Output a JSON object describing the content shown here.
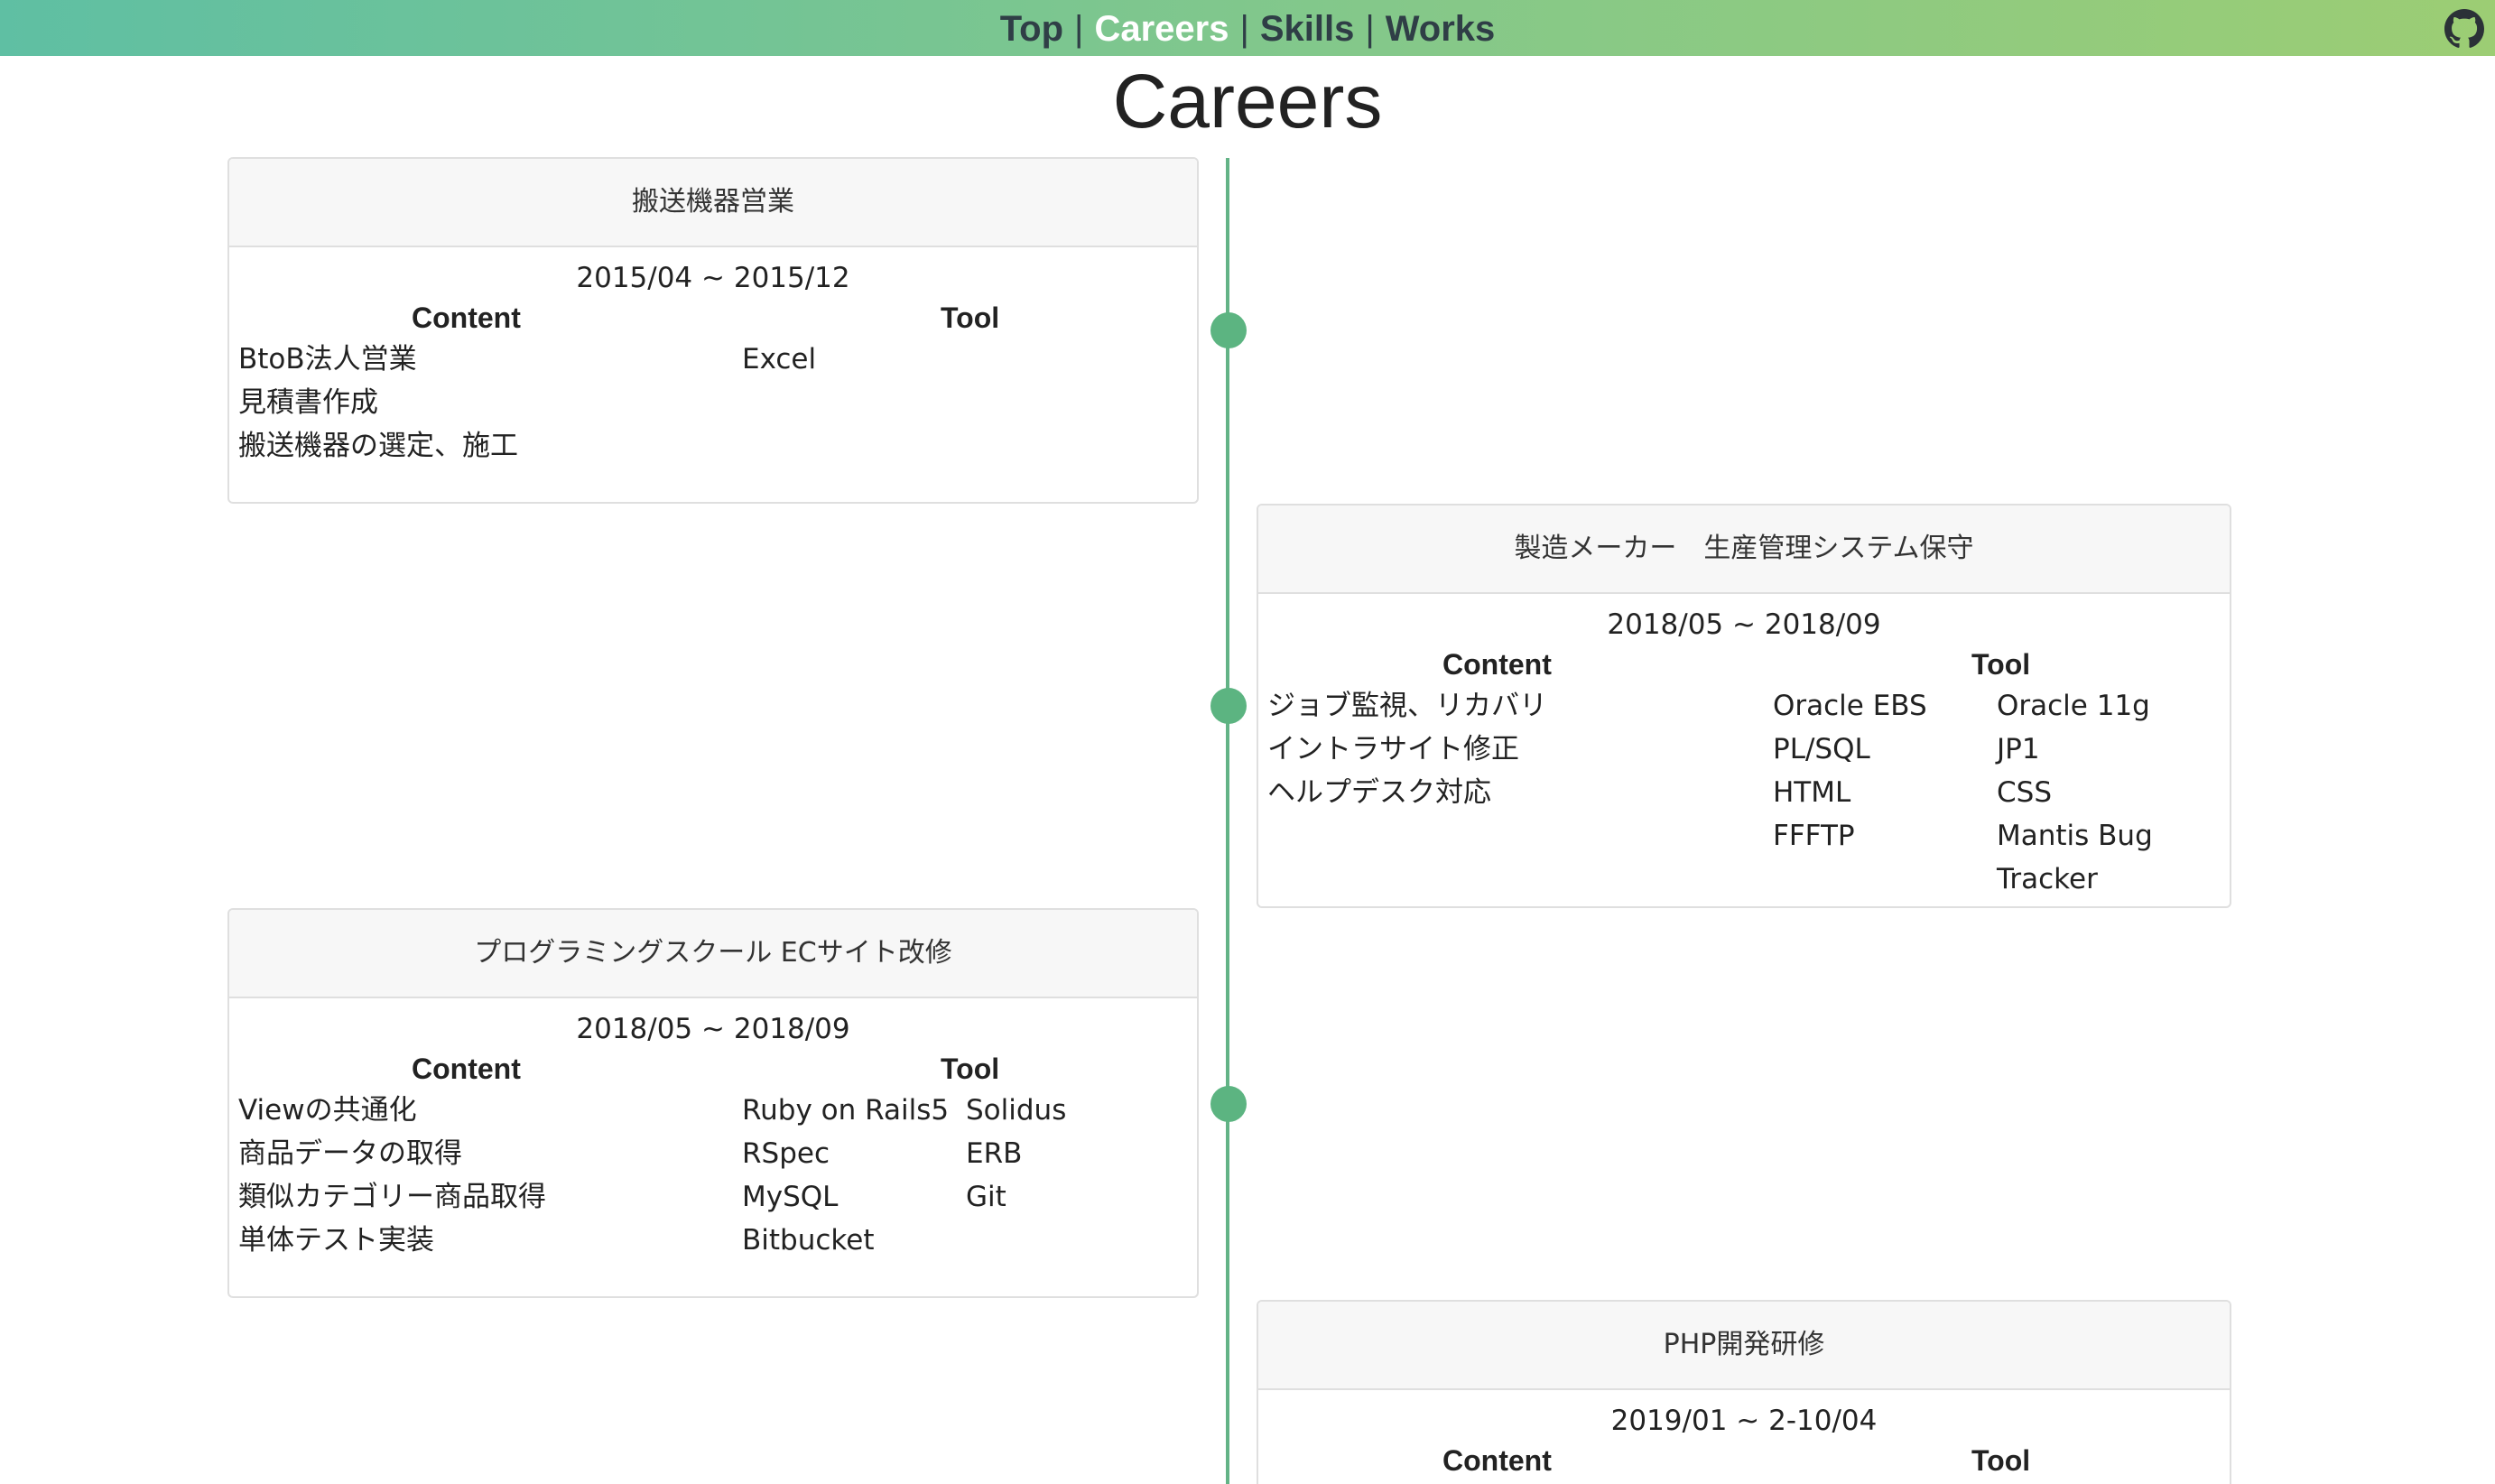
{
  "nav": {
    "links": [
      "Top",
      "Careers",
      "Skills",
      "Works"
    ],
    "separator": "|",
    "active": "Careers",
    "github_icon": "github-icon"
  },
  "page": {
    "title": "Careers"
  },
  "colors": {
    "accent": "#5cb481",
    "nav_gradient_start": "#5fbfa3",
    "nav_gradient_end": "#9ccd74",
    "active_link": "#ffffff"
  },
  "careers": [
    {
      "title": "搬送機器営業",
      "period": "2015/04 ~ 2015/12",
      "content_label": "Content",
      "tool_label": "Tool",
      "content": [
        "BtoB法人営業",
        "見積書作成",
        "搬送機器の選定、施工"
      ],
      "tools_col1": [
        "Excel"
      ],
      "tools_col2": []
    },
    {
      "title": "製造メーカー　生産管理システム保守",
      "period": "2018/05 ~ 2018/09",
      "content_label": "Content",
      "tool_label": "Tool",
      "content": [
        "ジョブ監視、リカバリ",
        "イントラサイト修正",
        "ヘルプデスク対応"
      ],
      "tools_col1": [
        "Oracle EBS",
        "PL/SQL",
        "HTML",
        "FFFTP"
      ],
      "tools_col2": [
        "Oracle 11g",
        "JP1",
        "CSS",
        "Mantis Bug",
        "Tracker"
      ]
    },
    {
      "title": "プログラミングスクール ECサイト改修",
      "period": "2018/05 ~ 2018/09",
      "content_label": "Content",
      "tool_label": "Tool",
      "content": [
        "Viewの共通化",
        "商品データの取得",
        "類似カテゴリー商品取得",
        "単体テスト実装"
      ],
      "tools_col1": [
        "Ruby on Rails5",
        "RSpec",
        "MySQL",
        "Bitbucket"
      ],
      "tools_col2": [
        "Solidus",
        "ERB",
        "Git"
      ]
    },
    {
      "title": "PHP開発研修",
      "period": "2019/01 ~ 2-10/04",
      "content_label": "Content",
      "tool_label": "Tool",
      "content": [],
      "tools_col1": [],
      "tools_col2": []
    }
  ]
}
